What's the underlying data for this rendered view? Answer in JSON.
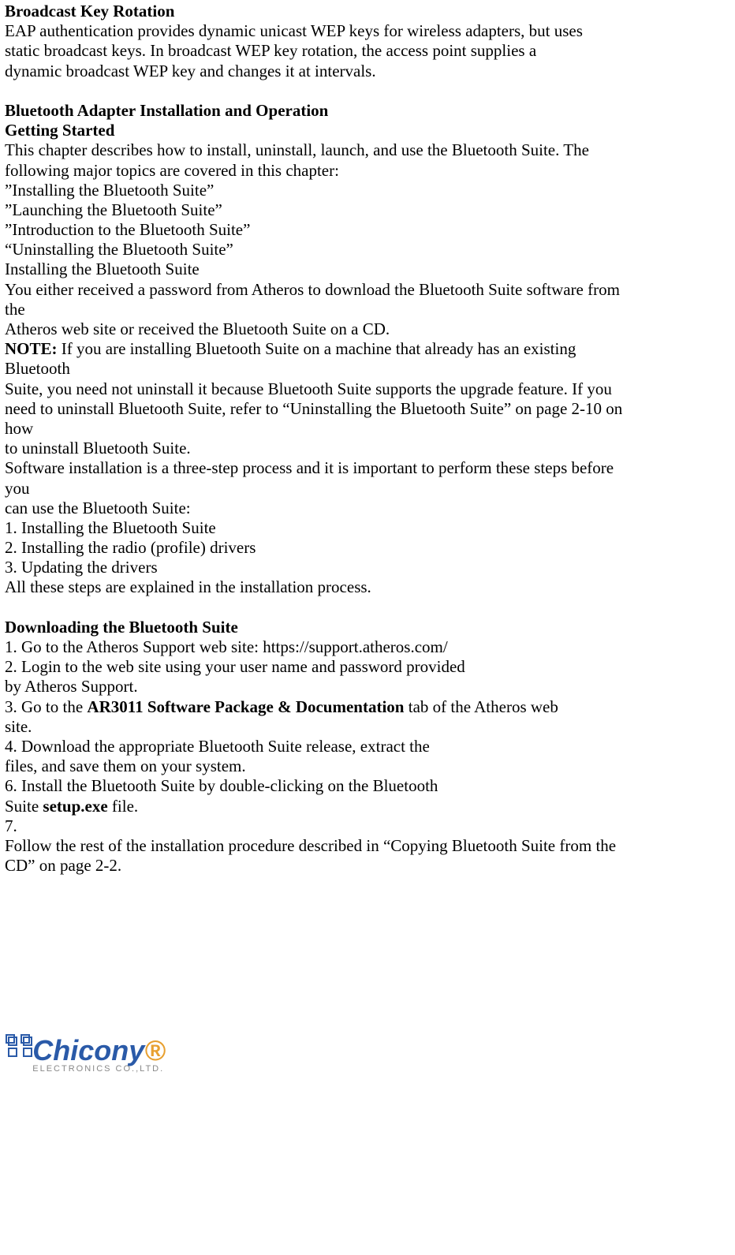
{
  "doc": {
    "h1": "Broadcast Key Rotation",
    "p1a": "EAP authentication provides dynamic unicast WEP keys for wireless adapters, but uses",
    "p1b": "static broadcast keys. In broadcast WEP key rotation, the access point supplies a",
    "p1c": "dynamic broadcast WEP key and changes it at intervals.",
    "h2": "Bluetooth Adapter Installation and Operation",
    "h3": "Getting Started",
    "p2a": "This chapter describes how to install, uninstall, launch, and use the Bluetooth Suite. The",
    "p2b": "following major topics are covered in this chapter:",
    "t1": "”Installing the Bluetooth Suite”",
    "t2": "”Launching the Bluetooth Suite”",
    "t3": "”Introduction to the Bluetooth Suite”",
    "t4": "“Uninstalling the Bluetooth Suite”",
    "h4": "Installing the Bluetooth Suite",
    "p3a": "You either received a password from Atheros to download the Bluetooth Suite software from",
    "p3b": "the",
    "p3c": "Atheros web site or received the Bluetooth Suite on a CD.",
    "noteLabel": "NOTE:",
    "noteA": " If you are installing Bluetooth Suite on a machine that already has an existing",
    "noteB": "Bluetooth",
    "noteC": "Suite, you need not uninstall it because Bluetooth Suite supports the upgrade feature. If you",
    "noteD": "need to uninstall Bluetooth Suite, refer to “Uninstalling the Bluetooth Suite” on page 2-10 on",
    "noteE": "how",
    "noteF": "to uninstall Bluetooth Suite.",
    "p4a": "Software installation is a three-step process and it is important to perform these steps before",
    "p4b": "you",
    "p4c": "can use the Bluetooth Suite:",
    "s1": "1. Installing the Bluetooth Suite",
    "s2": "2. Installing the radio (profile) drivers",
    "s3": "3. Updating the drivers",
    "p5": "All these steps are explained in the installation process.",
    "h5": "Downloading the Bluetooth Suite",
    "d1": "1. Go to the Atheros Support web site: https://support.atheros.com/",
    "d2": "2. Login to the web site using your user name and password provided",
    "d2b": "by Atheros Support.",
    "d3a": "3. Go to the ",
    "d3bold": "AR3011 Software Package & Documentation",
    "d3b": " tab of the Atheros web",
    "d3c": "site.",
    "d4a": "4. Download the appropriate Bluetooth Suite release, extract the",
    "d4b": "files, and save them on your system.",
    "d6a": "6. Install the Bluetooth Suite by double-clicking on the Bluetooth",
    "d6b_pre": "Suite ",
    "d6b_bold": "setup.exe",
    "d6b_post": " file.",
    "d7": "7.",
    "p6a": "Follow the rest of the installation procedure described in “Copying Bluetooth Suite from the",
    "p6b": "CD” on page 2-2.",
    "logo": {
      "name": "Chicony",
      "sub": "ELECTRONICS CO.,LTD."
    }
  }
}
